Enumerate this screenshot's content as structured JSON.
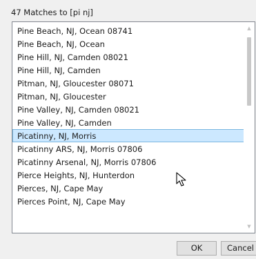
{
  "dialog": {
    "match_count_label": "47 Matches to [pi nj]"
  },
  "list": {
    "selected_index": 8,
    "items": [
      "Pine Beach, NJ, Ocean 08741",
      "Pine Beach, NJ, Ocean",
      "Pine Hill, NJ, Camden 08021",
      "Pine Hill, NJ, Camden",
      "Pitman, NJ, Gloucester 08071",
      "Pitman, NJ, Gloucester",
      "Pine Valley, NJ, Camden 08021",
      "Pine Valley, NJ, Camden",
      "Picatinny, NJ, Morris",
      "Picatinny ARS, NJ, Morris 07806",
      "Picatinny Arsenal, NJ, Morris 07806",
      "Pierce Heights, NJ, Hunterdon",
      "Pierces, NJ, Cape May",
      "Pierces Point, NJ, Cape May"
    ]
  },
  "buttons": {
    "ok_label": "OK",
    "cancel_label": "Cancel"
  },
  "colors": {
    "selection_fill": "#cce8ff",
    "selection_border": "#7ab6e0",
    "dialog_background": "#f0f0f0"
  },
  "icons": {
    "scroll_up": "scroll-up-arrow-icon",
    "scroll_down": "scroll-down-arrow-icon",
    "cursor": "mouse-pointer-icon"
  }
}
